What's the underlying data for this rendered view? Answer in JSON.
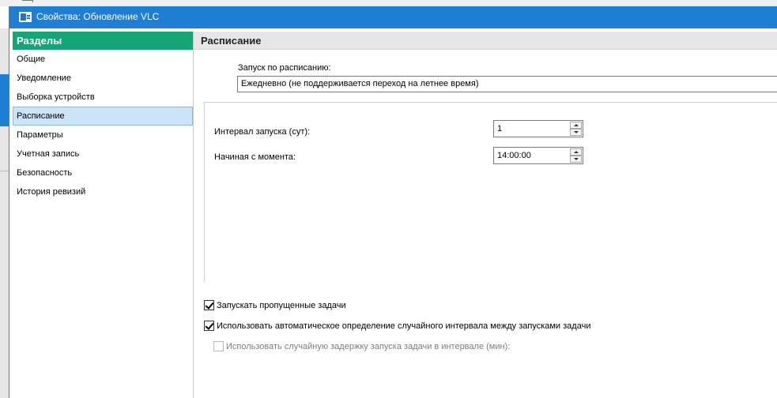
{
  "window": {
    "title": "Свойства: Обновление VLC"
  },
  "sidebar": {
    "header": "Разделы",
    "items": [
      {
        "label": "Общие",
        "active": false
      },
      {
        "label": "Уведомление",
        "active": false
      },
      {
        "label": "Выборка устройств",
        "active": false
      },
      {
        "label": "Расписание",
        "active": true
      },
      {
        "label": "Параметры",
        "active": false
      },
      {
        "label": "Учетная запись",
        "active": false
      },
      {
        "label": "Безопасность",
        "active": false
      },
      {
        "label": "История ревизий",
        "active": false
      }
    ]
  },
  "content": {
    "header": "Расписание",
    "schedule": {
      "label": "Запуск по расписанию:",
      "value": "Ежедневно (не поддерживается переход на летнее время)"
    },
    "interval": {
      "label": "Интервал запуска (сут):",
      "value": "1"
    },
    "start_from": {
      "label": "Начиная с момента:",
      "value": "14:00:00"
    },
    "checkboxes": {
      "run_missed": {
        "label": "Запускать пропущенные задачи",
        "checked": true,
        "enabled": true
      },
      "auto_random_interval": {
        "label": "Использовать автоматическое определение случайного интервала между запусками задачи",
        "checked": true,
        "enabled": true
      },
      "random_delay": {
        "label": "Использовать случайную задержку запуска задачи в интервале (мин):",
        "checked": false,
        "enabled": false
      }
    }
  },
  "colors": {
    "titlebar": "#1f7fd4",
    "sidebar_header": "#15a577",
    "selection": "#cce4f7",
    "content_header": "#e6e6e6"
  },
  "icons": {
    "window_icon": "properties-window-icon",
    "spin_up": "chevron-up-icon",
    "spin_down": "chevron-down-icon"
  }
}
